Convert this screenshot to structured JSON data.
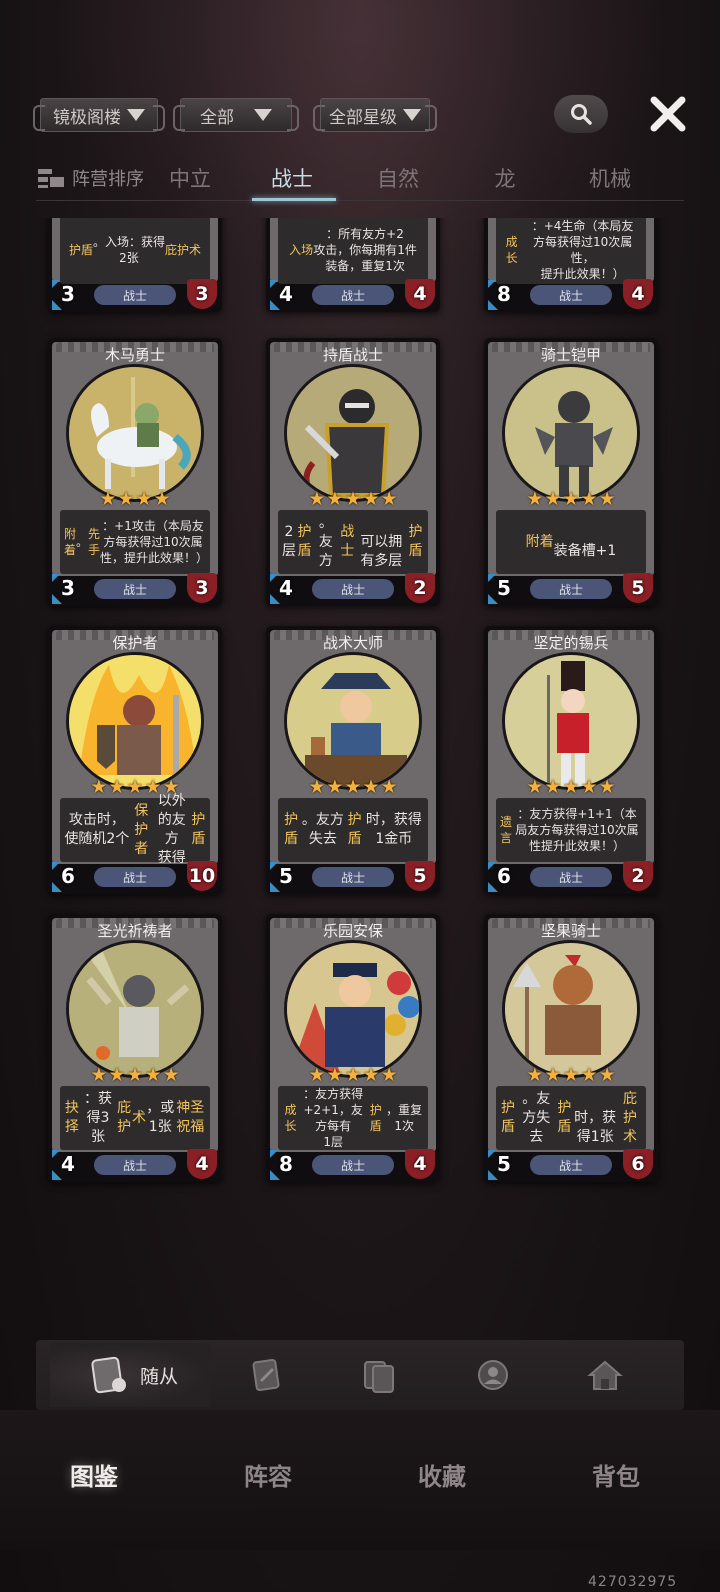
{
  "filters": {
    "location": "镜极阁楼",
    "category": "全部",
    "star_level": "全部星级"
  },
  "sort_label": "阵营排序",
  "tabs": [
    {
      "label": "中立",
      "active": false
    },
    {
      "label": "战士",
      "active": true
    },
    {
      "label": "自然",
      "active": false
    },
    {
      "label": "龙",
      "active": false
    },
    {
      "label": "机械",
      "active": false
    }
  ],
  "partial_cards": [
    {
      "desc_html": "<span class='hl'>护盾</span>。入场：获得<br>2张<span class='hl'>庇护术</span>",
      "cost": "3",
      "tribe": "战士",
      "hp": "3"
    },
    {
      "desc_html": "<span class='hl'>入场</span>：所有友方+2<br>攻击，你每拥有1件<br>装备，重复1次",
      "cost": "4",
      "tribe": "战士",
      "hp": "4"
    },
    {
      "desc_html": "<span class='hl'>成长</span>：+4生命（本局友<br>方每获得过10次属性，<br>提升此效果！）",
      "cost": "8",
      "tribe": "战士",
      "hp": "4"
    }
  ],
  "cards": [
    {
      "name": "木马勇士",
      "stars": 4,
      "desc_html": "<span class='hl'>附着</span>。<span class='hl'>先手</span>：+1攻击（本局友方每获得过10次属性，提升此效果！）",
      "big": false,
      "cost": "3",
      "tribe": "战士",
      "hp": "3",
      "art": "horse"
    },
    {
      "name": "持盾战士",
      "stars": 5,
      "desc_html": "2层<span class='hl'>护盾</span>。友方<span class='hl'>战士</span><br>可以拥有多层<span class='hl'>护盾</span>",
      "big": true,
      "cost": "4",
      "tribe": "战士",
      "hp": "2",
      "art": "shield"
    },
    {
      "name": "骑士铠甲",
      "stars": 5,
      "desc_html": "<span class='hl'>附着</span><br>装备槽+1",
      "big": true,
      "cost": "5",
      "tribe": "战士",
      "hp": "5",
      "art": "armor"
    },
    {
      "name": "保护者",
      "stars": 5,
      "desc_html": "攻击时，使随机2个<br><span class='hl'>保护者</span>以外的友方<br>获得<span class='hl'>护盾</span>",
      "big": true,
      "cost": "6",
      "tribe": "战士",
      "hp": "10",
      "art": "fire"
    },
    {
      "name": "战术大师",
      "stars": 5,
      "desc_html": "<span class='hl'>护盾</span>。友方失去<br><span class='hl'>护盾</span>时，获得1金币",
      "big": true,
      "cost": "5",
      "tribe": "战士",
      "hp": "5",
      "art": "pirate"
    },
    {
      "name": "坚定的锡兵",
      "stars": 5,
      "desc_html": "<span class='hl'>遗言</span>：友方获得+1+1（本局友方每获得过10次属性提升此效果！）",
      "big": false,
      "cost": "6",
      "tribe": "战士",
      "hp": "2",
      "art": "tin"
    },
    {
      "name": "圣光祈祷者",
      "stars": 5,
      "desc_html": "<span class='hl'>抉择</span>：获得3张<span class='hl'>庇护</span><br><span class='hl'>术</span>，或1张<span class='hl'>神圣祝福</span>",
      "big": true,
      "cost": "4",
      "tribe": "战士",
      "hp": "4",
      "art": "holy"
    },
    {
      "name": "乐园安保",
      "stars": 5,
      "desc_html": "<span class='hl'>成长</span>：友方获得<br>+2+1，友方每有<br>1层<span class='hl'>护盾</span>，重复1次",
      "big": false,
      "cost": "8",
      "tribe": "战士",
      "hp": "4",
      "art": "guard"
    },
    {
      "name": "坚果骑士",
      "stars": 5,
      "desc_html": "<span class='hl'>护盾</span>。友方失去<span class='hl'>护盾</span><br>时，获得1张<span class='hl'>庇护术</span>",
      "big": true,
      "cost": "5",
      "tribe": "战士",
      "hp": "6",
      "art": "nut"
    }
  ],
  "subnav": {
    "active_label": "随从",
    "icons": [
      "minion-card-icon",
      "spell-card-icon",
      "equipment-card-icon",
      "hero-icon",
      "house-icon"
    ]
  },
  "mainnav": [
    "图鉴",
    "阵容",
    "收藏",
    "背包"
  ],
  "uid": "427032975",
  "colors": {
    "accent_tab": "#c9dde6",
    "keyword": "#f2c35b",
    "cost": "#3b8cc0",
    "hp": "#8a1f26",
    "star": "#f3b03a"
  }
}
